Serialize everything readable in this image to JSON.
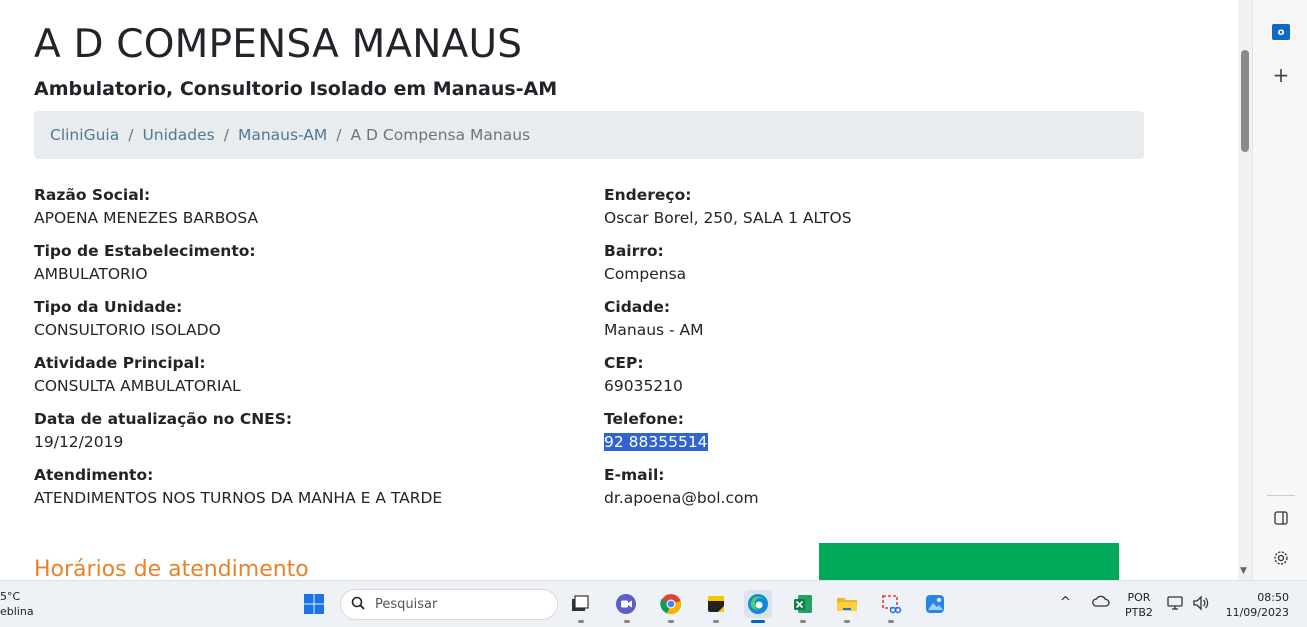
{
  "page": {
    "title": "A D COMPENSA MANAUS",
    "subtitle": "Ambulatorio, Consultorio Isolado em Manaus-AM",
    "breadcrumb": [
      "CliniGuia",
      "Unidades",
      "Manaus-AM",
      "A D Compensa Manaus"
    ],
    "breadcrumb_sep": "/",
    "left_fields": [
      {
        "label": "Razão Social:",
        "value": "APOENA MENEZES BARBOSA"
      },
      {
        "label": "Tipo de Estabelecimento:",
        "value": "AMBULATORIO"
      },
      {
        "label": "Tipo da Unidade:",
        "value": "CONSULTORIO ISOLADO"
      },
      {
        "label": "Atividade Principal:",
        "value": "CONSULTA AMBULATORIAL"
      },
      {
        "label": "Data de atualização no CNES:",
        "value": "19/12/2019"
      },
      {
        "label": "Atendimento:",
        "value": "ATENDIMENTOS NOS TURNOS DA MANHA E A TARDE"
      }
    ],
    "right_fields": [
      {
        "label": "Endereço:",
        "value": "Oscar Borel, 250, SALA 1 ALTOS"
      },
      {
        "label": "Bairro:",
        "value": "Compensa"
      },
      {
        "label": "Cidade:",
        "value": "Manaus - AM"
      },
      {
        "label": "CEP:",
        "value": "69035210"
      },
      {
        "label": "Telefone:",
        "value": "92 88355514"
      },
      {
        "label": "E-mail:",
        "value": "dr.apoena@bol.com"
      }
    ],
    "section_title": "Horários de atendimento"
  },
  "colors": {
    "accent_orange": "#e8822a",
    "breadcrumb_bg": "#e9ecef",
    "selection": "#3164d0",
    "ad_green": "#00a85a"
  },
  "sidebar": {
    "icons": [
      "outlook-icon",
      "plus-icon",
      "split-screen-icon",
      "gear-icon"
    ],
    "outlook_letter": "o",
    "plus_glyph": "+"
  },
  "taskbar": {
    "weather_temp": "5°C",
    "weather_desc": "eblina",
    "search_placeholder": "Pesquisar",
    "apps": [
      "start",
      "search",
      "file-explorer-task",
      "meet",
      "chrome",
      "sticky-notes",
      "edge",
      "excel",
      "folder",
      "snipping-tool",
      "photos"
    ],
    "tray_chevron": "^",
    "lang_line1": "POR",
    "lang_line2": "PTB2",
    "time": "08:50",
    "date": "11/09/2023"
  }
}
